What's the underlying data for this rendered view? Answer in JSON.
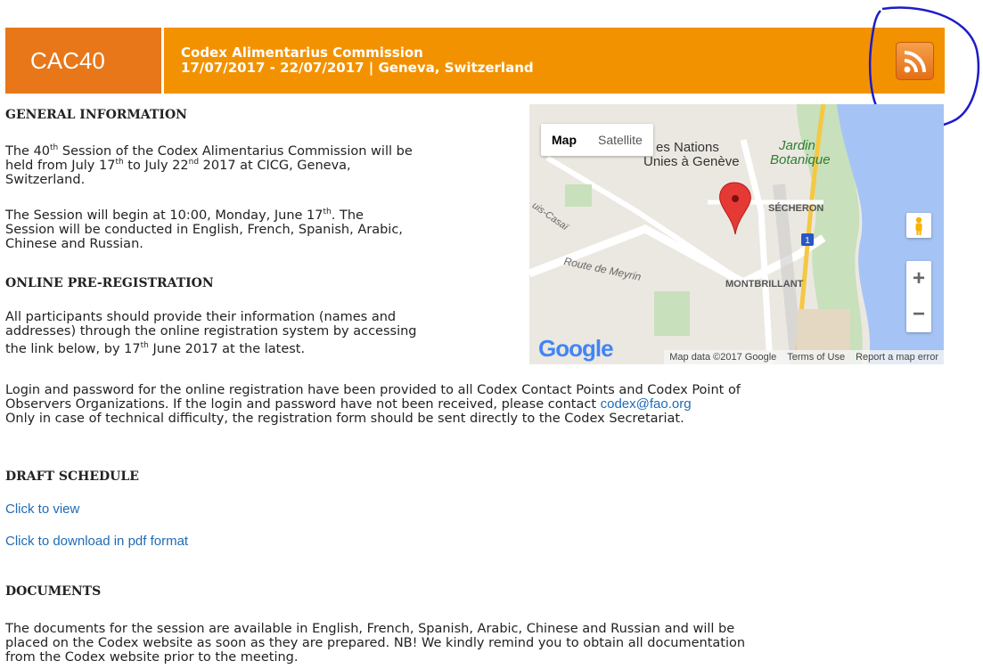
{
  "banner": {
    "code": "CAC40",
    "title": "Codex Alimentarius Commission",
    "dates": "17/07/2017 - 22/07/2017 | Geneva, Switzerland",
    "rss_icon": "rss-feed-icon"
  },
  "general": {
    "heading": "GENERAL INFORMATION",
    "p1_a": "The 40",
    "p1_sup1": "th",
    "p1_b": " Session of the Codex Alimentarius Commission will be",
    "p1_c": "held from July 17",
    "p1_sup2": "th",
    "p1_d": " to July 22",
    "p1_sup3": "nd",
    "p1_e": " 2017 at CICG, Geneva,",
    "p1_f": "Switzerland.",
    "p2_a": "The Session will begin at 10:00, Monday, June 17",
    "p2_sup": "th",
    "p2_b": ". The",
    "p2_c": "Session will be conducted in English, French, Spanish, Arabic,",
    "p2_d": "Chinese and Russian."
  },
  "prereg": {
    "heading": "ONLINE PRE-REGISTRATION",
    "l1": "All participants should provide their information (names and",
    "l2": "addresses) through the online registration system by accessing",
    "l3_a": "the link below, by 17",
    "l3_sup": "th",
    "l3_b": " June 2017 at the latest."
  },
  "login": {
    "l1": "Login and password for the online registration have been provided to all Codex Contact Points and Codex Point of",
    "l2": "Observers Organizations. If the login and password have not been received, please contact ",
    "email": "codex@fao.org",
    "l3": "Only in case of technical difficulty, the registration form should be sent directly to the Codex Secretariat."
  },
  "schedule": {
    "heading": "DRAFT SCHEDULE",
    "view_link": "Click to view",
    "pdf_link": "Click to download in pdf format"
  },
  "documents": {
    "heading": "DOCUMENTS",
    "l1": "The documents for the session are available in English, French, Spanish, Arabic, Chinese and Russian and will be",
    "l2": "placed on the Codex website as soon as they are prepared. NB! We kindly remind you to obtain all documentation",
    "l3": "from the Codex website prior to the meeting."
  },
  "map": {
    "tab_map": "Map",
    "tab_satellite": "Satellite",
    "label_nations1": "es Nations",
    "label_nations2": "Unies à Genève",
    "label_jardin1": "Jardin",
    "label_jardin2": "Botanique",
    "label_secheron": "SÉCHERON",
    "label_montbrillant": "MONTBRILLANT",
    "label_meyrin": "Route de Meyrin",
    "label_casai": "uis-Casaï",
    "zoom_in": "+",
    "zoom_out": "−",
    "logo": "Google",
    "footer_data": "Map data ©2017 Google",
    "footer_terms": "Terms of Use",
    "footer_report": "Report a map error",
    "route_number": "1"
  }
}
